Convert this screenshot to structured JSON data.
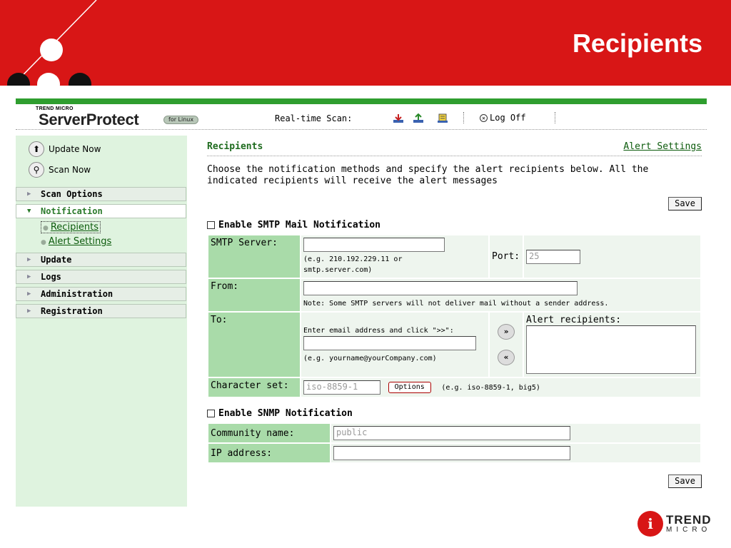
{
  "slide": {
    "title": "Recipients"
  },
  "brand": {
    "company": "TREND MICRO",
    "product": "ServerProtect",
    "edition": "for Linux"
  },
  "header": {
    "realtime_label": "Real-time Scan:",
    "logoff_label": "Log Off"
  },
  "sidebar": {
    "update_now": "Update Now",
    "scan_now": "Scan Now",
    "items": [
      "Scan Options",
      "Notification",
      "Update",
      "Logs",
      "Administration",
      "Registration"
    ],
    "sub_items": [
      "Recipients",
      "Alert Settings"
    ]
  },
  "main": {
    "title": "Recipients",
    "alert_link": "Alert Settings",
    "intro": "Choose the notification methods and specify the alert recipients below. All the indicated recipients will receive the alert messages",
    "save_label": "Save",
    "smtp": {
      "enable_label": "Enable SMTP Mail Notification",
      "server_label": "SMTP Server:",
      "server_value": "",
      "server_hint": "(e.g. 210.192.229.11 or smtp.server.com)",
      "port_label": "Port:",
      "port_value": "25",
      "from_label": "From:",
      "from_value": "",
      "from_note": "Note: Some SMTP servers will not deliver mail without a sender address.",
      "to_label": "To:",
      "to_instruction": "Enter email address and click \">>\":",
      "to_value": "",
      "to_hint": "(e.g. yourname@yourCompany.com)",
      "add_glyph": "»",
      "remove_glyph": "«",
      "recipients_label": "Alert recipients:",
      "charset_label": "Character set:",
      "charset_value": "iso-8859-1",
      "options_label": "Options",
      "charset_hint": "(e.g. iso-8859-1, big5)"
    },
    "snmp": {
      "enable_label": "Enable SNMP Notification",
      "community_label": "Community name:",
      "community_value": "public",
      "ip_label": "IP address:",
      "ip_value": ""
    }
  },
  "footer": {
    "logo_word": "TREND",
    "logo_sub": "MICRO"
  },
  "colors": {
    "header_red": "#d81616",
    "accent_green": "#2f9e2f",
    "sidebar_bg": "#dff3df",
    "label_green": "#a9dba9"
  }
}
